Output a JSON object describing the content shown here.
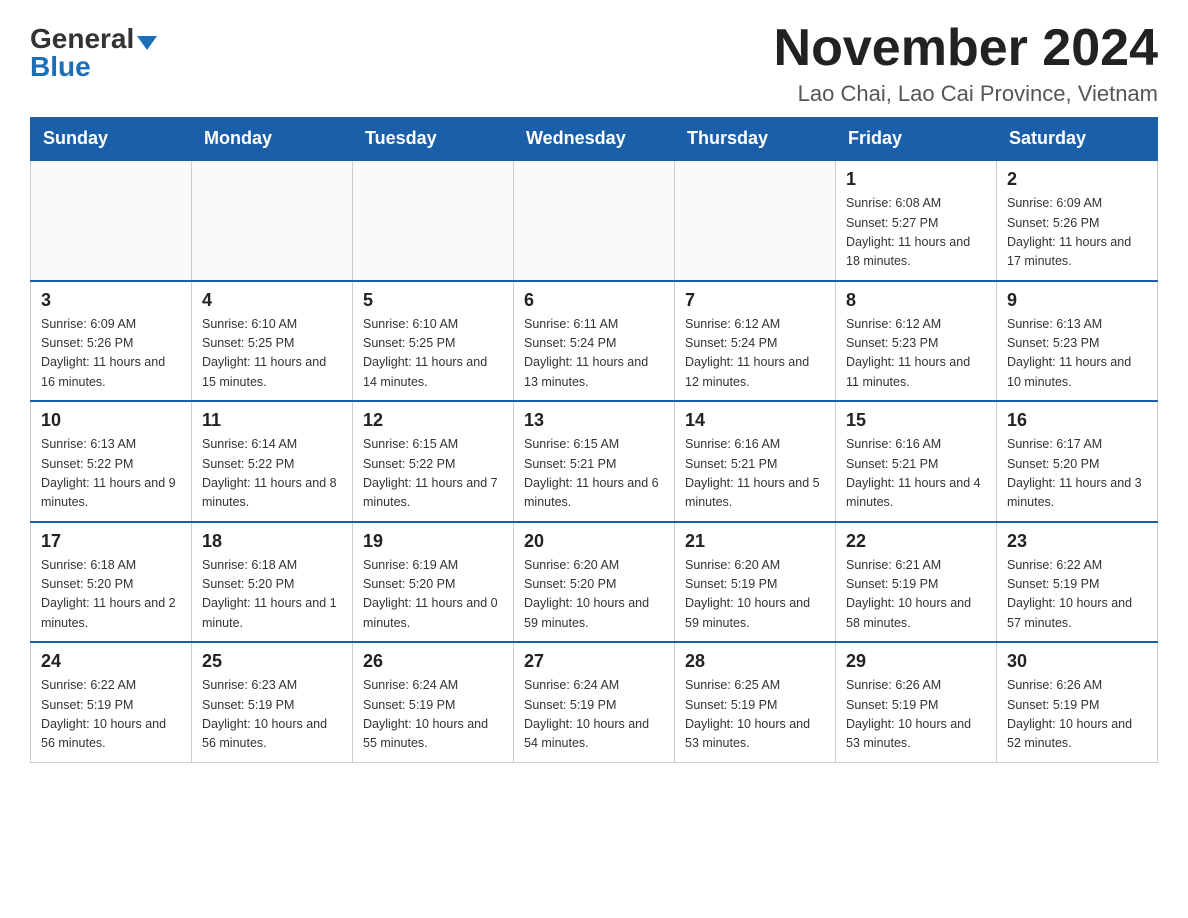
{
  "header": {
    "logo_general": "General",
    "logo_blue": "Blue",
    "title": "November 2024",
    "subtitle": "Lao Chai, Lao Cai Province, Vietnam"
  },
  "days_of_week": [
    "Sunday",
    "Monday",
    "Tuesday",
    "Wednesday",
    "Thursday",
    "Friday",
    "Saturday"
  ],
  "weeks": [
    [
      {
        "day": "",
        "info": ""
      },
      {
        "day": "",
        "info": ""
      },
      {
        "day": "",
        "info": ""
      },
      {
        "day": "",
        "info": ""
      },
      {
        "day": "",
        "info": ""
      },
      {
        "day": "1",
        "info": "Sunrise: 6:08 AM\nSunset: 5:27 PM\nDaylight: 11 hours and 18 minutes."
      },
      {
        "day": "2",
        "info": "Sunrise: 6:09 AM\nSunset: 5:26 PM\nDaylight: 11 hours and 17 minutes."
      }
    ],
    [
      {
        "day": "3",
        "info": "Sunrise: 6:09 AM\nSunset: 5:26 PM\nDaylight: 11 hours and 16 minutes."
      },
      {
        "day": "4",
        "info": "Sunrise: 6:10 AM\nSunset: 5:25 PM\nDaylight: 11 hours and 15 minutes."
      },
      {
        "day": "5",
        "info": "Sunrise: 6:10 AM\nSunset: 5:25 PM\nDaylight: 11 hours and 14 minutes."
      },
      {
        "day": "6",
        "info": "Sunrise: 6:11 AM\nSunset: 5:24 PM\nDaylight: 11 hours and 13 minutes."
      },
      {
        "day": "7",
        "info": "Sunrise: 6:12 AM\nSunset: 5:24 PM\nDaylight: 11 hours and 12 minutes."
      },
      {
        "day": "8",
        "info": "Sunrise: 6:12 AM\nSunset: 5:23 PM\nDaylight: 11 hours and 11 minutes."
      },
      {
        "day": "9",
        "info": "Sunrise: 6:13 AM\nSunset: 5:23 PM\nDaylight: 11 hours and 10 minutes."
      }
    ],
    [
      {
        "day": "10",
        "info": "Sunrise: 6:13 AM\nSunset: 5:22 PM\nDaylight: 11 hours and 9 minutes."
      },
      {
        "day": "11",
        "info": "Sunrise: 6:14 AM\nSunset: 5:22 PM\nDaylight: 11 hours and 8 minutes."
      },
      {
        "day": "12",
        "info": "Sunrise: 6:15 AM\nSunset: 5:22 PM\nDaylight: 11 hours and 7 minutes."
      },
      {
        "day": "13",
        "info": "Sunrise: 6:15 AM\nSunset: 5:21 PM\nDaylight: 11 hours and 6 minutes."
      },
      {
        "day": "14",
        "info": "Sunrise: 6:16 AM\nSunset: 5:21 PM\nDaylight: 11 hours and 5 minutes."
      },
      {
        "day": "15",
        "info": "Sunrise: 6:16 AM\nSunset: 5:21 PM\nDaylight: 11 hours and 4 minutes."
      },
      {
        "day": "16",
        "info": "Sunrise: 6:17 AM\nSunset: 5:20 PM\nDaylight: 11 hours and 3 minutes."
      }
    ],
    [
      {
        "day": "17",
        "info": "Sunrise: 6:18 AM\nSunset: 5:20 PM\nDaylight: 11 hours and 2 minutes."
      },
      {
        "day": "18",
        "info": "Sunrise: 6:18 AM\nSunset: 5:20 PM\nDaylight: 11 hours and 1 minute."
      },
      {
        "day": "19",
        "info": "Sunrise: 6:19 AM\nSunset: 5:20 PM\nDaylight: 11 hours and 0 minutes."
      },
      {
        "day": "20",
        "info": "Sunrise: 6:20 AM\nSunset: 5:20 PM\nDaylight: 10 hours and 59 minutes."
      },
      {
        "day": "21",
        "info": "Sunrise: 6:20 AM\nSunset: 5:19 PM\nDaylight: 10 hours and 59 minutes."
      },
      {
        "day": "22",
        "info": "Sunrise: 6:21 AM\nSunset: 5:19 PM\nDaylight: 10 hours and 58 minutes."
      },
      {
        "day": "23",
        "info": "Sunrise: 6:22 AM\nSunset: 5:19 PM\nDaylight: 10 hours and 57 minutes."
      }
    ],
    [
      {
        "day": "24",
        "info": "Sunrise: 6:22 AM\nSunset: 5:19 PM\nDaylight: 10 hours and 56 minutes."
      },
      {
        "day": "25",
        "info": "Sunrise: 6:23 AM\nSunset: 5:19 PM\nDaylight: 10 hours and 56 minutes."
      },
      {
        "day": "26",
        "info": "Sunrise: 6:24 AM\nSunset: 5:19 PM\nDaylight: 10 hours and 55 minutes."
      },
      {
        "day": "27",
        "info": "Sunrise: 6:24 AM\nSunset: 5:19 PM\nDaylight: 10 hours and 54 minutes."
      },
      {
        "day": "28",
        "info": "Sunrise: 6:25 AM\nSunset: 5:19 PM\nDaylight: 10 hours and 53 minutes."
      },
      {
        "day": "29",
        "info": "Sunrise: 6:26 AM\nSunset: 5:19 PM\nDaylight: 10 hours and 53 minutes."
      },
      {
        "day": "30",
        "info": "Sunrise: 6:26 AM\nSunset: 5:19 PM\nDaylight: 10 hours and 52 minutes."
      }
    ]
  ]
}
